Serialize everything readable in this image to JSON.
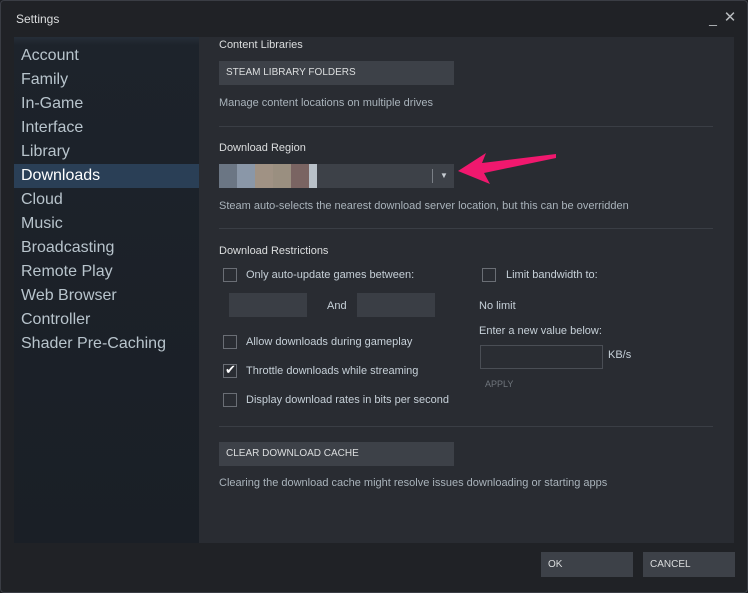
{
  "window": {
    "title": "Settings",
    "minimize_glyph": "_",
    "close_glyph": "✕"
  },
  "sidebar": {
    "items": [
      {
        "label": "Account"
      },
      {
        "label": "Family"
      },
      {
        "label": "In-Game"
      },
      {
        "label": "Interface"
      },
      {
        "label": "Library"
      },
      {
        "label": "Downloads",
        "active": true
      },
      {
        "label": "Cloud"
      },
      {
        "label": "Music"
      },
      {
        "label": "Broadcasting"
      },
      {
        "label": "Remote Play"
      },
      {
        "label": "Web Browser"
      },
      {
        "label": "Controller"
      },
      {
        "label": "Shader Pre-Caching"
      }
    ]
  },
  "content_libraries": {
    "title": "Content Libraries",
    "button": "STEAM LIBRARY FOLDERS",
    "description": "Manage content locations on multiple drives"
  },
  "download_region": {
    "title": "Download Region",
    "selected_value_hidden": true,
    "description": "Steam auto-selects the nearest download server location, but this can be overridden"
  },
  "download_restrictions": {
    "title": "Download Restrictions",
    "auto_update": {
      "label": "Only auto-update games between:",
      "checked": false,
      "from": "",
      "to": "",
      "and_label": "And"
    },
    "allow_during_gameplay": {
      "label": "Allow downloads during gameplay",
      "checked": false
    },
    "throttle_streaming": {
      "label": "Throttle downloads while streaming",
      "checked": true
    },
    "bits_per_second": {
      "label": "Display download rates in bits per second",
      "checked": false
    },
    "limit_bandwidth": {
      "label": "Limit bandwidth to:",
      "checked": false
    },
    "current_limit": "No limit",
    "new_value_label": "Enter a new value below:",
    "new_value": "",
    "unit": "KB/s",
    "apply_label": "APPLY"
  },
  "download_cache": {
    "button": "CLEAR DOWNLOAD CACHE",
    "description": "Clearing the download cache might resolve issues downloading or starting apps"
  },
  "footer": {
    "ok": "OK",
    "cancel": "CANCEL"
  },
  "colors": {
    "accent_arrow": "#f0186e",
    "active_item": "#2a3f56",
    "button_bg": "#3d4148",
    "content_bg": "#292c32"
  },
  "icons": {
    "check": "check-icon",
    "dropdown": "chevron-down-icon",
    "arrow": "pointer-arrow-icon"
  }
}
